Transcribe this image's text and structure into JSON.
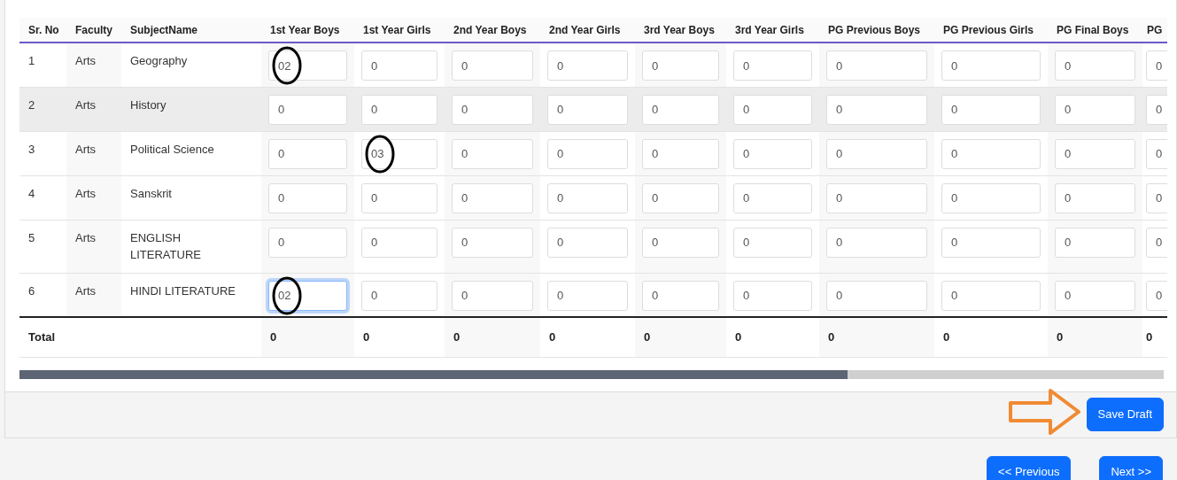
{
  "table": {
    "columns": [
      "Sr. No",
      "Faculty",
      "SubjectName",
      "1st Year Boys",
      "1st Year Girls",
      "2nd Year Boys",
      "2nd Year Girls",
      "3rd Year Boys",
      "3rd Year Girls",
      "PG Previous Boys",
      "PG Previous Girls",
      "PG Final Boys",
      "PG"
    ],
    "rows": [
      {
        "highlighted": false,
        "cells": [
          {
            "kind": "text",
            "value": "1"
          },
          {
            "kind": "text",
            "value": "Arts"
          },
          {
            "kind": "text",
            "value": "Geography"
          },
          {
            "kind": "input",
            "value": "02",
            "circled": true,
            "focused": false
          },
          {
            "kind": "input",
            "value": "0",
            "circled": false,
            "focused": false
          },
          {
            "kind": "input",
            "value": "0",
            "circled": false,
            "focused": false
          },
          {
            "kind": "input",
            "value": "0",
            "circled": false,
            "focused": false
          },
          {
            "kind": "input",
            "value": "0",
            "circled": false,
            "focused": false
          },
          {
            "kind": "input",
            "value": "0",
            "circled": false,
            "focused": false
          },
          {
            "kind": "input",
            "value": "0",
            "circled": false,
            "focused": false
          },
          {
            "kind": "input",
            "value": "0",
            "circled": false,
            "focused": false
          },
          {
            "kind": "input",
            "value": "0",
            "circled": false,
            "focused": false
          },
          {
            "kind": "input",
            "value": "0",
            "circled": false,
            "focused": false
          }
        ]
      },
      {
        "highlighted": true,
        "cells": [
          {
            "kind": "text",
            "value": "2"
          },
          {
            "kind": "text",
            "value": "Arts"
          },
          {
            "kind": "text",
            "value": "History"
          },
          {
            "kind": "input",
            "value": "0",
            "circled": false,
            "focused": false
          },
          {
            "kind": "input",
            "value": "0",
            "circled": false,
            "focused": false
          },
          {
            "kind": "input",
            "value": "0",
            "circled": false,
            "focused": false
          },
          {
            "kind": "input",
            "value": "0",
            "circled": false,
            "focused": false
          },
          {
            "kind": "input",
            "value": "0",
            "circled": false,
            "focused": false
          },
          {
            "kind": "input",
            "value": "0",
            "circled": false,
            "focused": false
          },
          {
            "kind": "input",
            "value": "0",
            "circled": false,
            "focused": false
          },
          {
            "kind": "input",
            "value": "0",
            "circled": false,
            "focused": false
          },
          {
            "kind": "input",
            "value": "0",
            "circled": false,
            "focused": false
          },
          {
            "kind": "input",
            "value": "0",
            "circled": false,
            "focused": false
          }
        ]
      },
      {
        "highlighted": false,
        "cells": [
          {
            "kind": "text",
            "value": "3"
          },
          {
            "kind": "text",
            "value": "Arts"
          },
          {
            "kind": "text",
            "value": "Political Science"
          },
          {
            "kind": "input",
            "value": "0",
            "circled": false,
            "focused": false
          },
          {
            "kind": "input",
            "value": "03",
            "circled": true,
            "focused": false
          },
          {
            "kind": "input",
            "value": "0",
            "circled": false,
            "focused": false
          },
          {
            "kind": "input",
            "value": "0",
            "circled": false,
            "focused": false
          },
          {
            "kind": "input",
            "value": "0",
            "circled": false,
            "focused": false
          },
          {
            "kind": "input",
            "value": "0",
            "circled": false,
            "focused": false
          },
          {
            "kind": "input",
            "value": "0",
            "circled": false,
            "focused": false
          },
          {
            "kind": "input",
            "value": "0",
            "circled": false,
            "focused": false
          },
          {
            "kind": "input",
            "value": "0",
            "circled": false,
            "focused": false
          },
          {
            "kind": "input",
            "value": "0",
            "circled": false,
            "focused": false
          }
        ]
      },
      {
        "highlighted": false,
        "cells": [
          {
            "kind": "text",
            "value": "4"
          },
          {
            "kind": "text",
            "value": "Arts"
          },
          {
            "kind": "text",
            "value": "Sanskrit"
          },
          {
            "kind": "input",
            "value": "0",
            "circled": false,
            "focused": false
          },
          {
            "kind": "input",
            "value": "0",
            "circled": false,
            "focused": false
          },
          {
            "kind": "input",
            "value": "0",
            "circled": false,
            "focused": false
          },
          {
            "kind": "input",
            "value": "0",
            "circled": false,
            "focused": false
          },
          {
            "kind": "input",
            "value": "0",
            "circled": false,
            "focused": false
          },
          {
            "kind": "input",
            "value": "0",
            "circled": false,
            "focused": false
          },
          {
            "kind": "input",
            "value": "0",
            "circled": false,
            "focused": false
          },
          {
            "kind": "input",
            "value": "0",
            "circled": false,
            "focused": false
          },
          {
            "kind": "input",
            "value": "0",
            "circled": false,
            "focused": false
          },
          {
            "kind": "input",
            "value": "0",
            "circled": false,
            "focused": false
          }
        ]
      },
      {
        "highlighted": false,
        "cells": [
          {
            "kind": "text",
            "value": "5"
          },
          {
            "kind": "text",
            "value": "Arts"
          },
          {
            "kind": "text",
            "value": "ENGLISH LITERATURE"
          },
          {
            "kind": "input",
            "value": "0",
            "circled": false,
            "focused": false
          },
          {
            "kind": "input",
            "value": "0",
            "circled": false,
            "focused": false
          },
          {
            "kind": "input",
            "value": "0",
            "circled": false,
            "focused": false
          },
          {
            "kind": "input",
            "value": "0",
            "circled": false,
            "focused": false
          },
          {
            "kind": "input",
            "value": "0",
            "circled": false,
            "focused": false
          },
          {
            "kind": "input",
            "value": "0",
            "circled": false,
            "focused": false
          },
          {
            "kind": "input",
            "value": "0",
            "circled": false,
            "focused": false
          },
          {
            "kind": "input",
            "value": "0",
            "circled": false,
            "focused": false
          },
          {
            "kind": "input",
            "value": "0",
            "circled": false,
            "focused": false
          },
          {
            "kind": "input",
            "value": "0",
            "circled": false,
            "focused": false
          }
        ]
      },
      {
        "highlighted": false,
        "cells": [
          {
            "kind": "text",
            "value": "6"
          },
          {
            "kind": "text",
            "value": "Arts"
          },
          {
            "kind": "text",
            "value": "HINDI LITERATURE"
          },
          {
            "kind": "input",
            "value": "02",
            "circled": true,
            "focused": true
          },
          {
            "kind": "input",
            "value": "0",
            "circled": false,
            "focused": false
          },
          {
            "kind": "input",
            "value": "0",
            "circled": false,
            "focused": false
          },
          {
            "kind": "input",
            "value": "0",
            "circled": false,
            "focused": false
          },
          {
            "kind": "input",
            "value": "0",
            "circled": false,
            "focused": false
          },
          {
            "kind": "input",
            "value": "0",
            "circled": false,
            "focused": false
          },
          {
            "kind": "input",
            "value": "0",
            "circled": false,
            "focused": false
          },
          {
            "kind": "input",
            "value": "0",
            "circled": false,
            "focused": false
          },
          {
            "kind": "input",
            "value": "0",
            "circled": false,
            "focused": false
          },
          {
            "kind": "input",
            "value": "0",
            "circled": false,
            "focused": false
          }
        ]
      }
    ],
    "total": {
      "label": "Total",
      "values": [
        "0",
        "0",
        "0",
        "0",
        "0",
        "0",
        "0",
        "0",
        "0",
        "0"
      ]
    }
  },
  "save_draft": {
    "label": "Save Draft",
    "arrow": true
  },
  "navigation": [
    "<< Previous",
    "Next >>"
  ]
}
